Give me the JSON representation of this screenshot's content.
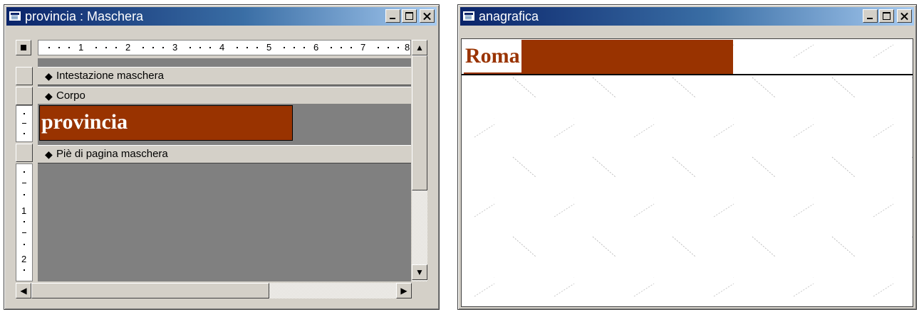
{
  "windows": {
    "design": {
      "title": "provincia : Maschera",
      "ruler_numbers": [
        "1",
        "2",
        "3",
        "4",
        "5",
        "6",
        "7",
        "8"
      ],
      "vertical_ruler_numbers": [
        "1",
        "2"
      ],
      "sections": {
        "header": "Intestazione maschera",
        "detail": "Corpo",
        "footer": "Piè di pagina maschera"
      },
      "field_textbox": "provincia"
    },
    "form": {
      "title": "anagrafica",
      "field_value": "Roma"
    }
  },
  "icons": {
    "section_pointer": "◆",
    "scroll_up": "▲",
    "scroll_down": "▼",
    "scroll_left": "◀",
    "scroll_right": "▶"
  },
  "colors": {
    "field_bg": "#993300",
    "title_bar_start": "#0a246a",
    "title_bar_end": "#a6caf0",
    "design_bg": "#808080"
  }
}
